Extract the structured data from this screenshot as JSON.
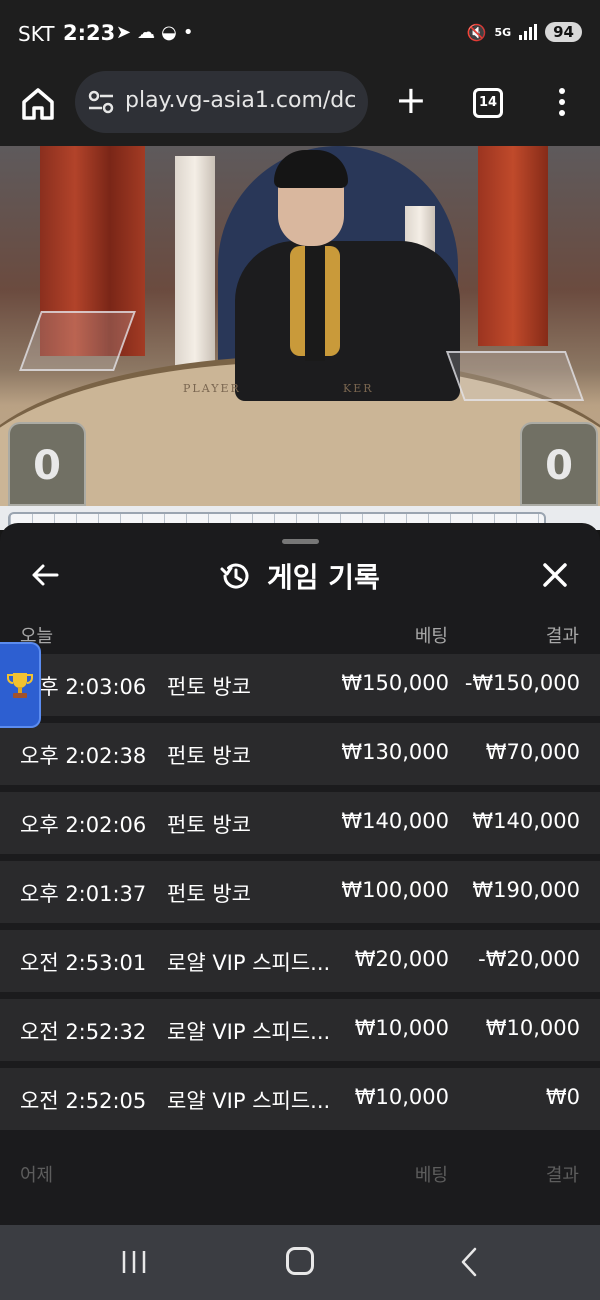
{
  "status_bar": {
    "carrier": "SKT",
    "time": "2:23",
    "network": "5G",
    "battery": "94",
    "notification_icons": [
      "telegram-icon",
      "chat-bubble-icon",
      "bowl-icon",
      "dot-icon"
    ]
  },
  "browser": {
    "url": "play.vg-asia1.com/dc",
    "tab_count": "14"
  },
  "video": {
    "table_left_label": "PLAYER",
    "table_right_label": "KER",
    "player_score": "0",
    "banker_score": "0"
  },
  "history": {
    "title": "게임 기록",
    "today": {
      "label": "오늘",
      "bet_header": "베팅",
      "result_header": "결과",
      "rows": [
        {
          "time": "오후 2:03:06",
          "game": "펀토 방코",
          "bet": "₩150,000",
          "result": "-₩150,000"
        },
        {
          "time": "오후 2:02:38",
          "game": "펀토 방코",
          "bet": "₩130,000",
          "result": "₩70,000"
        },
        {
          "time": "오후 2:02:06",
          "game": "펀토 방코",
          "bet": "₩140,000",
          "result": "₩140,000"
        },
        {
          "time": "오후 2:01:37",
          "game": "펀토 방코",
          "bet": "₩100,000",
          "result": "₩190,000"
        },
        {
          "time": "오전 2:53:01",
          "game": "로얄 VIP 스피드...",
          "bet": "₩20,000",
          "result": "-₩20,000"
        },
        {
          "time": "오전 2:52:32",
          "game": "로얄 VIP 스피드...",
          "bet": "₩10,000",
          "result": "₩10,000"
        },
        {
          "time": "오전 2:52:05",
          "game": "로얄 VIP 스피드...",
          "bet": "₩10,000",
          "result": "₩0"
        }
      ]
    },
    "yesterday": {
      "label": "어제",
      "bet_header": "베팅",
      "result_header": "결과"
    }
  },
  "colors": {
    "panel_bg": "#1b1b1d",
    "row_bg": "#2a2a2c",
    "trophy_tab": "#2d5fd1",
    "navbar": "#3b3d42"
  }
}
